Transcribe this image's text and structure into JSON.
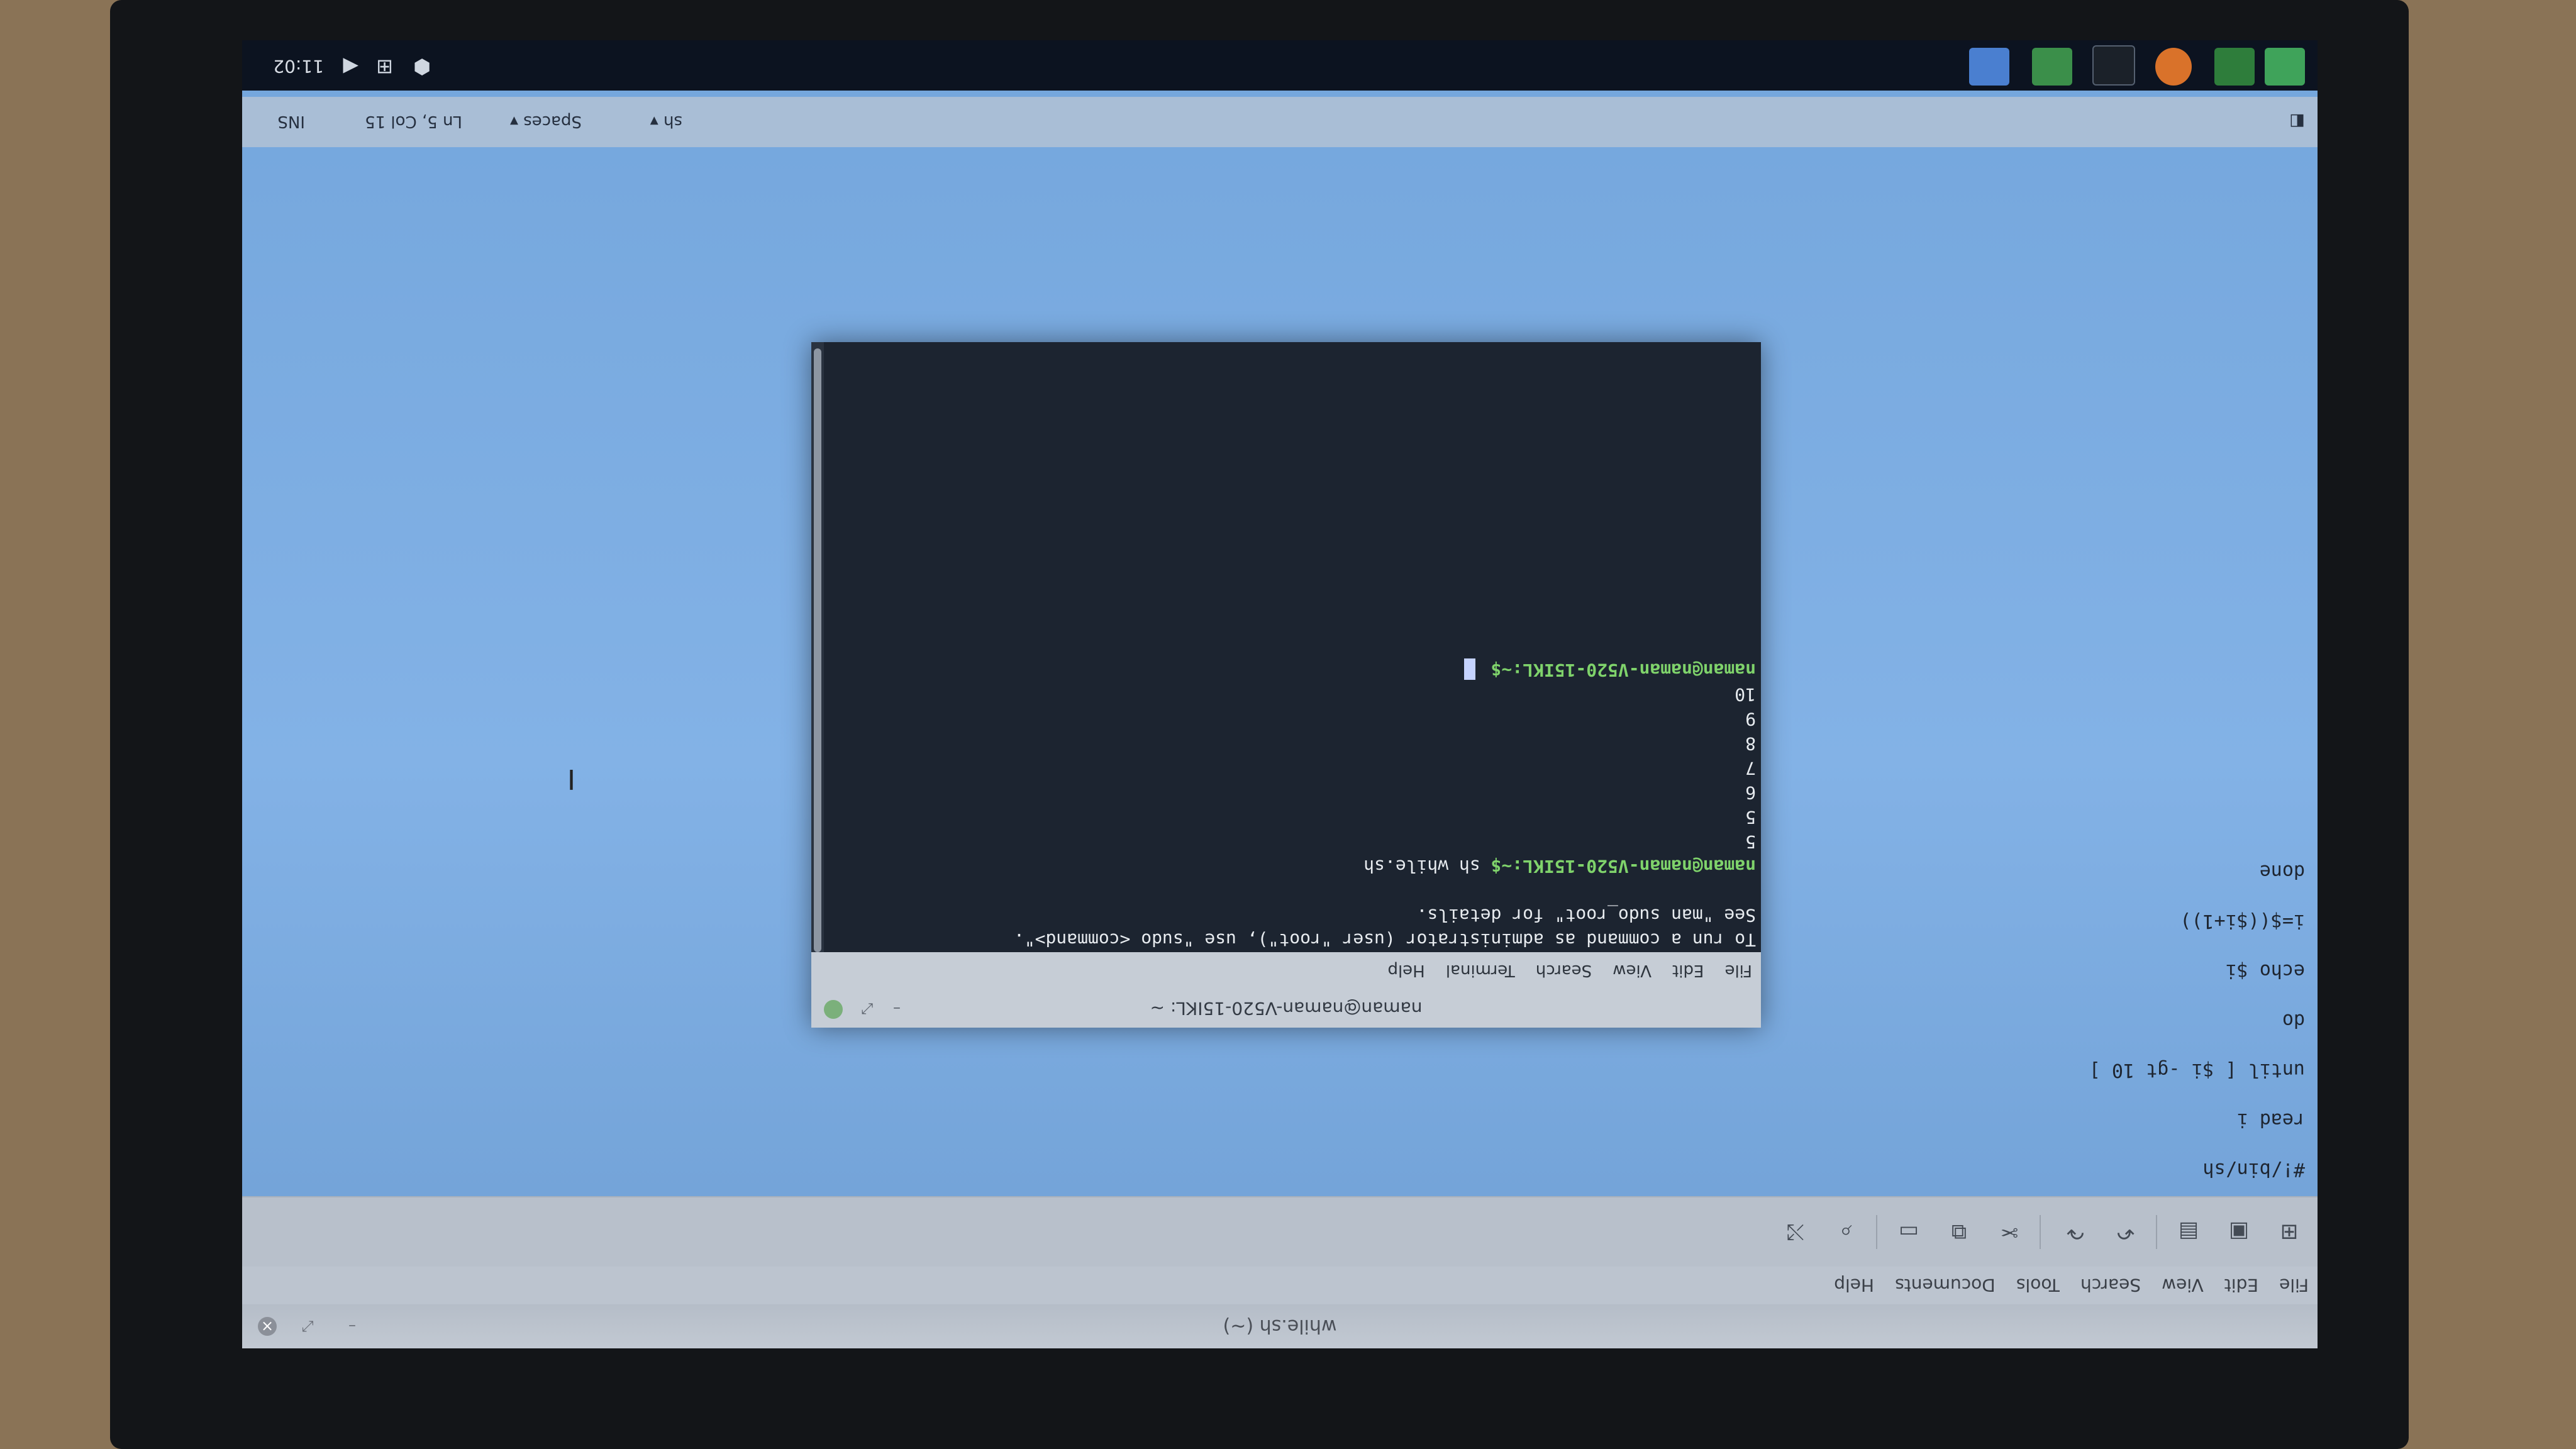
{
  "editor": {
    "title": "while.sh (~)",
    "menu": [
      "File",
      "Edit",
      "View",
      "Search",
      "Tools",
      "Documents",
      "Help"
    ],
    "toolbar_icons": [
      "new-document-icon",
      "open-icon",
      "save-icon",
      "undo-icon",
      "redo-icon",
      "cut-icon",
      "copy-icon",
      "paste-icon",
      "find-icon",
      "replace-icon"
    ],
    "code_lines": [
      "#!/bin/sh",
      "read i",
      "until [ $i -gt 10 ]",
      "do",
      "echo $i",
      "i=$(($i+1))",
      "done"
    ],
    "status": {
      "language": "sh",
      "indent": "Spaces",
      "position": "Ln 5, Col 15",
      "mode": "INS"
    }
  },
  "terminal": {
    "title": "naman@naman-V520-15IKL: ~",
    "menu": [
      "File",
      "Edit",
      "View",
      "Search",
      "Terminal",
      "Help"
    ],
    "lines": [
      {
        "text": "To run a command as administrator (user \"root\"), use \"sudo <command>\"."
      },
      {
        "text": "See \"man sudo_root\" for details."
      },
      {
        "text": ""
      },
      {
        "prompt": "naman@naman-V520-15IKL:~$",
        "text": " sh while.sh"
      },
      {
        "text": "5"
      },
      {
        "text": "5"
      },
      {
        "text": "6"
      },
      {
        "text": "7"
      },
      {
        "text": "8"
      },
      {
        "text": "9"
      },
      {
        "text": "10"
      },
      {
        "prompt": "naman@naman-V520-15IKL:~$",
        "text": " "
      }
    ]
  },
  "panel": {
    "clock": "11:02",
    "apps": [
      "mint-menu-icon",
      "show-desktop-icon",
      "firefox-icon",
      "terminal-icon",
      "files-icon",
      "text-editor-icon"
    ],
    "tray_icons": [
      "volume-icon",
      "network-icon",
      "update-shield-icon"
    ]
  },
  "colors": {
    "prompt_green": "#7fd36b",
    "terminal_bg": "#1c2430",
    "desktop_blue": "#83b2e6"
  }
}
